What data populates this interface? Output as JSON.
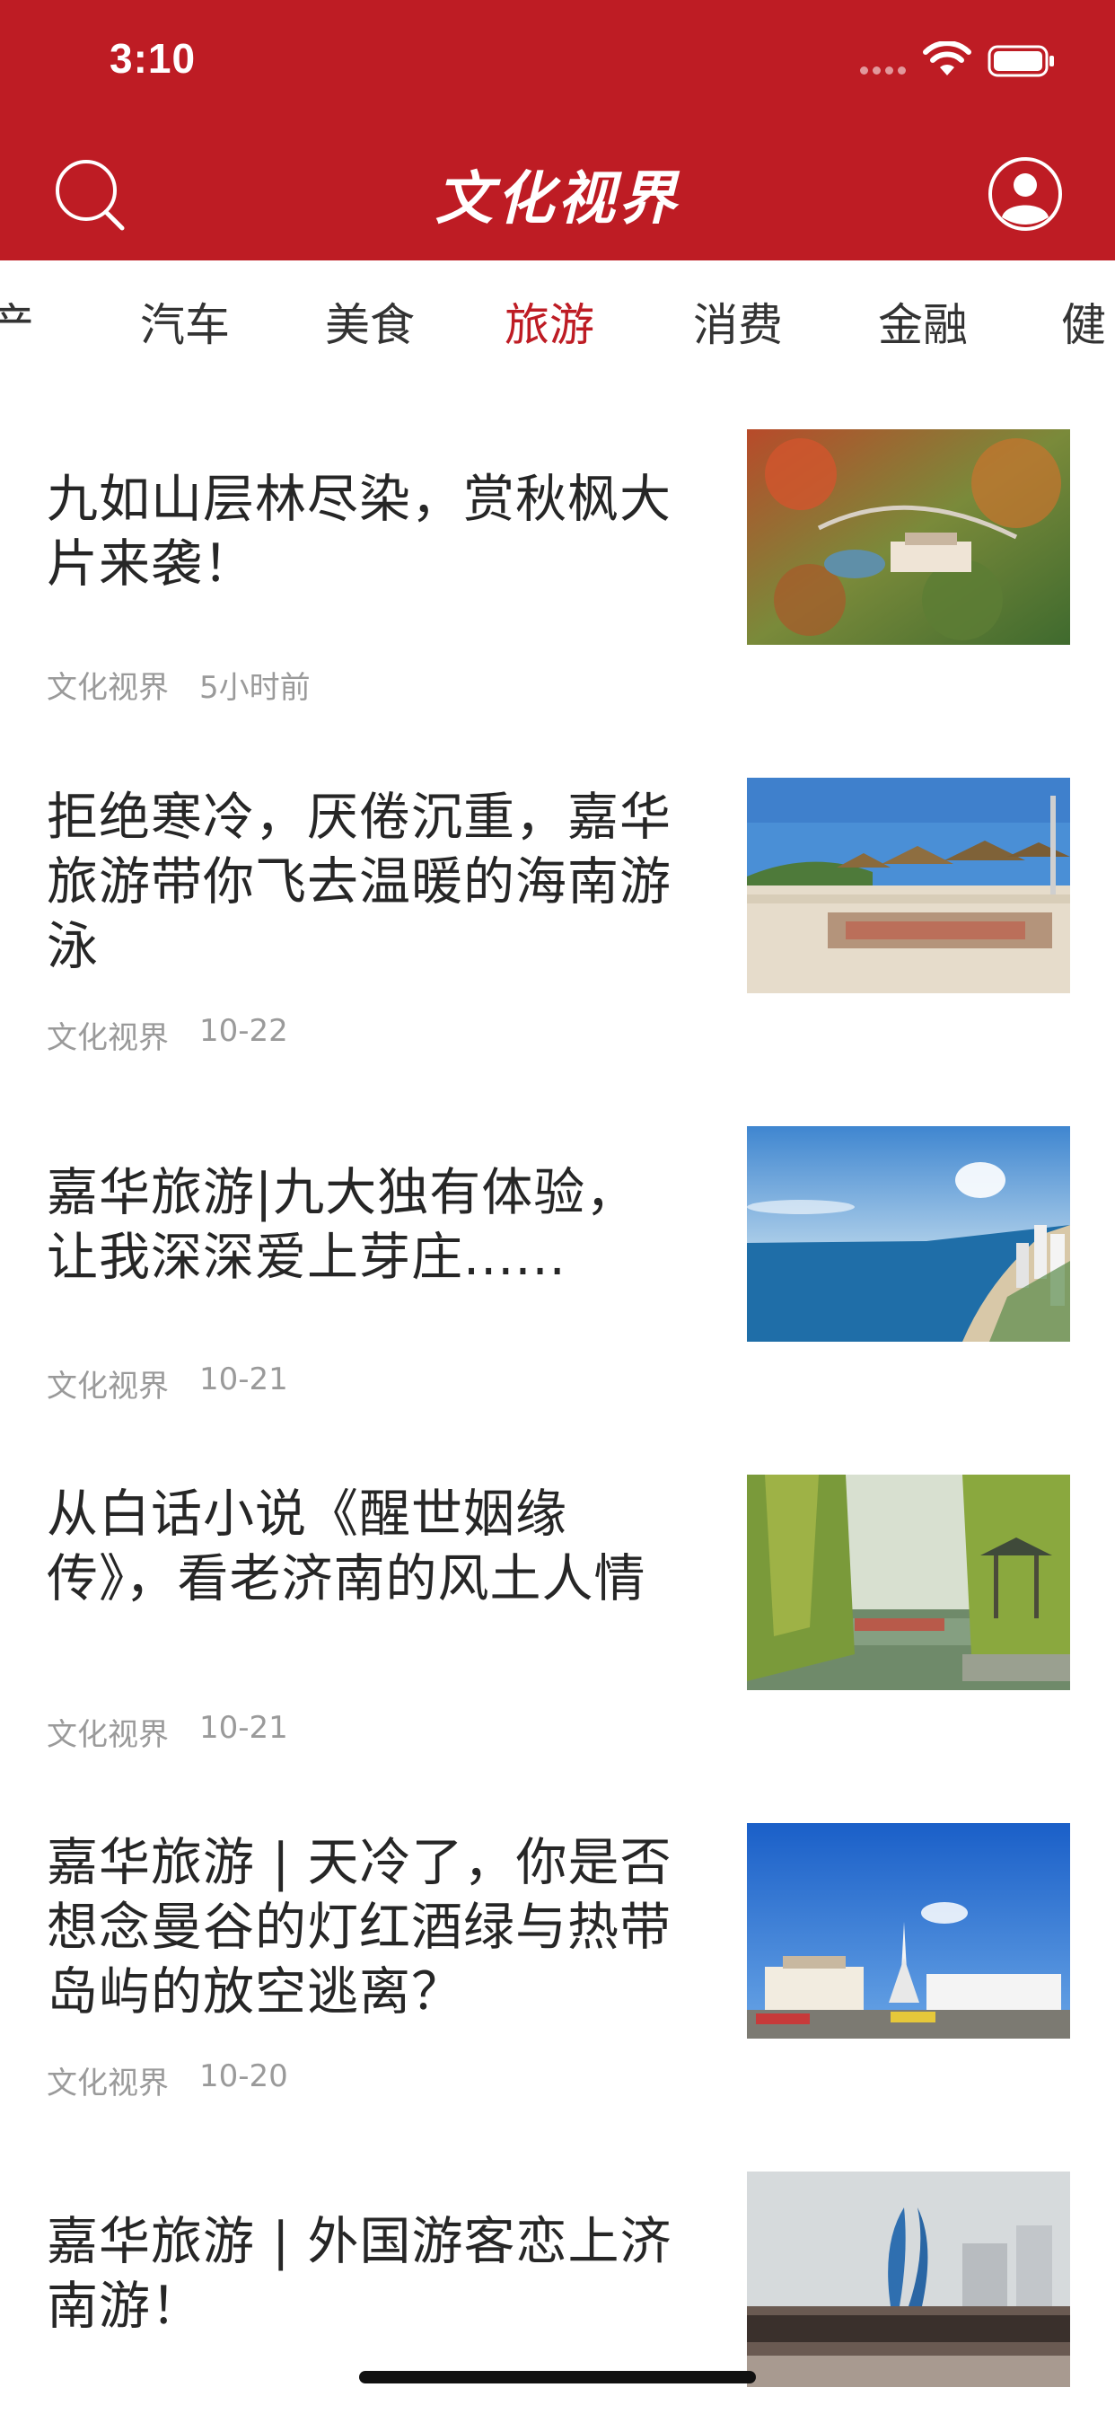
{
  "status_bar": {
    "time": "3:10"
  },
  "header": {
    "title": "文化视界"
  },
  "tabs": [
    {
      "label": "产"
    },
    {
      "label": "汽车"
    },
    {
      "label": "美食"
    },
    {
      "label": "旅游",
      "active": true
    },
    {
      "label": "消费"
    },
    {
      "label": "金融"
    },
    {
      "label": "健"
    }
  ],
  "articles": [
    {
      "title": "九如山层林尽染，赏秋枫大片来袭！",
      "source": "文化视界",
      "time": "5小时前",
      "image": "autumn-mountain-resort"
    },
    {
      "title": "拒绝寒冷，厌倦沉重，嘉华旅游带你飞去温暖的海南游泳",
      "source": "文化视界",
      "time": "10-22",
      "image": "beach-umbrellas"
    },
    {
      "title": "嘉华旅游|九大独有体验，让我深深爱上芽庄......",
      "source": "文化视界",
      "time": "10-21",
      "image": "coastal-city-bay"
    },
    {
      "title": "从白话小说《醒世姻缘传》，看老济南的风土人情",
      "source": "文化视界",
      "time": "10-21",
      "image": "willow-lake-pavilion"
    },
    {
      "title": "嘉华旅游 | 天冷了，你是否想念曼谷的灯红酒绿与热带岛屿的放空逃离？",
      "source": "文化视界",
      "time": "10-20",
      "image": "city-square-pagoda"
    },
    {
      "title": "嘉华旅游 | 外国游客恋上济南游！",
      "source": "",
      "time": "",
      "image": "monument-crowd"
    }
  ],
  "colors": {
    "brand_red": "#be1c24",
    "active_tab": "#be1c24",
    "meta_gray": "#9a9a9a"
  }
}
